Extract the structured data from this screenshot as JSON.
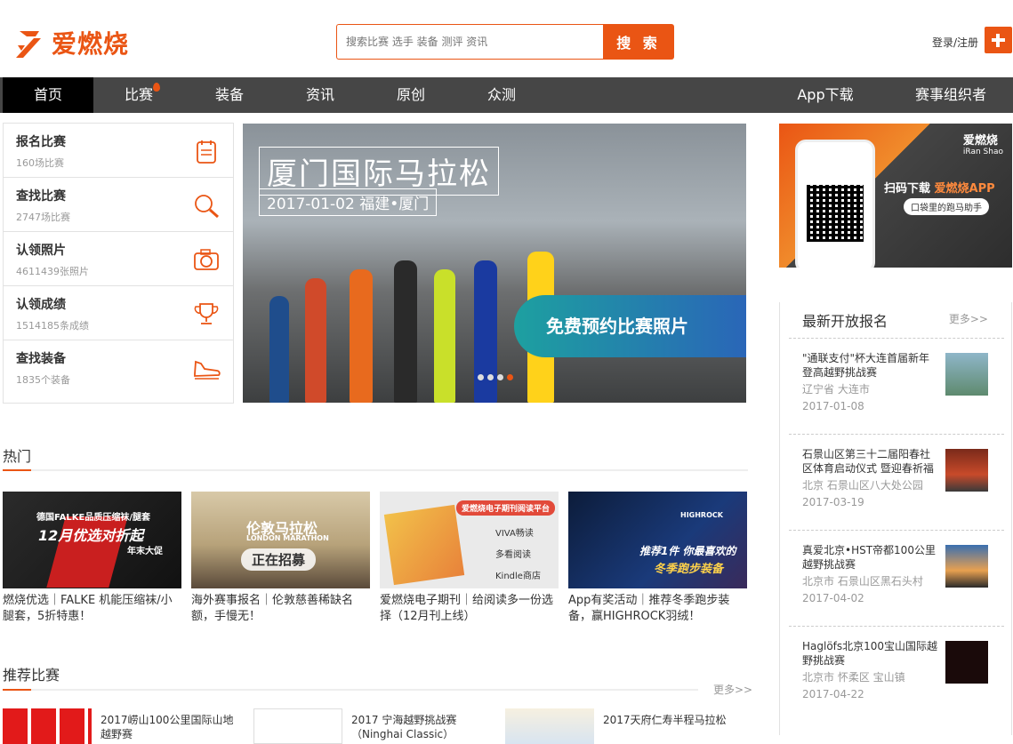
{
  "header": {
    "logo_text": "爱燃烧",
    "search_placeholder": "搜索比赛 选手 装备 测评 资讯",
    "search_button": "搜 索",
    "login": "登录/注册"
  },
  "nav": {
    "items": [
      "首页",
      "比赛",
      "装备",
      "资讯",
      "原创",
      "众测"
    ],
    "right_items": [
      "App下载",
      "赛事组织者"
    ]
  },
  "quick_links": [
    {
      "title": "报名比赛",
      "sub": "160场比赛",
      "icon": "clipboard-icon"
    },
    {
      "title": "查找比赛",
      "sub": "2747场比赛",
      "icon": "magnifier-icon"
    },
    {
      "title": "认领照片",
      "sub": "4611439张照片",
      "icon": "camera-icon"
    },
    {
      "title": "认领成绩",
      "sub": "1514185条成绩",
      "icon": "trophy-icon"
    },
    {
      "title": "查找装备",
      "sub": "1835个装备",
      "icon": "shoe-icon"
    }
  ],
  "banner": {
    "title": "厦门国际马拉松",
    "date": "2017-01-02 福建•厦门",
    "cta": "免费预约比赛照片",
    "dots_count": 4,
    "active_dot": 3
  },
  "app_ad": {
    "brand": "爱燃烧",
    "brand_sub": "iRan Shao",
    "scan_prefix": "扫码下载 ",
    "scan_app": "爱燃烧APP",
    "pill": "口袋里的跑马助手"
  },
  "side": {
    "title": "最新开放报名",
    "more": "更多>>",
    "items": [
      {
        "name": "\"通联支付\"杯大连首届新年登高越野挑战赛",
        "loc": "辽宁省 大连市",
        "date": "2017-01-08"
      },
      {
        "name": "石景山区第三十二届阳春社区体育启动仪式 暨迎春祈福",
        "loc": "北京 石景山区八大处公园",
        "date": "2017-03-19"
      },
      {
        "name": "真爱北京•HST帝都100公里越野挑战赛",
        "loc": "北京市 石景山区黑石头村",
        "date": "2017-04-02"
      },
      {
        "name": "Haglöfs北京100宝山国际越野挑战赛",
        "loc": "北京市 怀柔区 宝山镇",
        "date": "2017-04-22"
      }
    ]
  },
  "hot": {
    "title": "热门",
    "cards": [
      {
        "caption": "燃烧优选｜FALKE 机能压缩袜/小腿套，5折特惠！",
        "img_line1": "德国FALKE品质压缩袜/腿套",
        "img_line2": "12月优选对折起",
        "img_line3": "年末大促"
      },
      {
        "caption": "海外赛事报名｜伦敦慈善稀缺名额，手慢无！",
        "img_line1": "伦敦马拉松",
        "img_line2": "LONDON MARATHON",
        "img_line3": "正在招募"
      },
      {
        "caption": "爱燃烧电子期刊｜给阅读多一份选择（12月刊上线）",
        "img_line1": "爱燃烧电子期刊阅读平台",
        "img_line2": "VIVA畅读",
        "img_line3": "多看阅读",
        "img_line4": "Kindle商店"
      },
      {
        "caption": "App有奖活动｜推荐冬季跑步装备，赢HIGHROCK羽绒！",
        "img_line1": "推荐1件 你最喜欢的",
        "img_line2": "冬季跑步装备",
        "img_line3": "HIGHROCK"
      }
    ]
  },
  "recommend": {
    "title": "推荐比赛",
    "more": "更多>>",
    "items": [
      {
        "name": "2017崂山100公里国际山地越野赛"
      },
      {
        "name": "2017 宁海越野挑战赛（Ninghai Classic）"
      },
      {
        "name": "2017天府仁寿半程马拉松"
      }
    ]
  },
  "colors": {
    "accent": "#ea5514",
    "nav_bg": "#464646"
  }
}
